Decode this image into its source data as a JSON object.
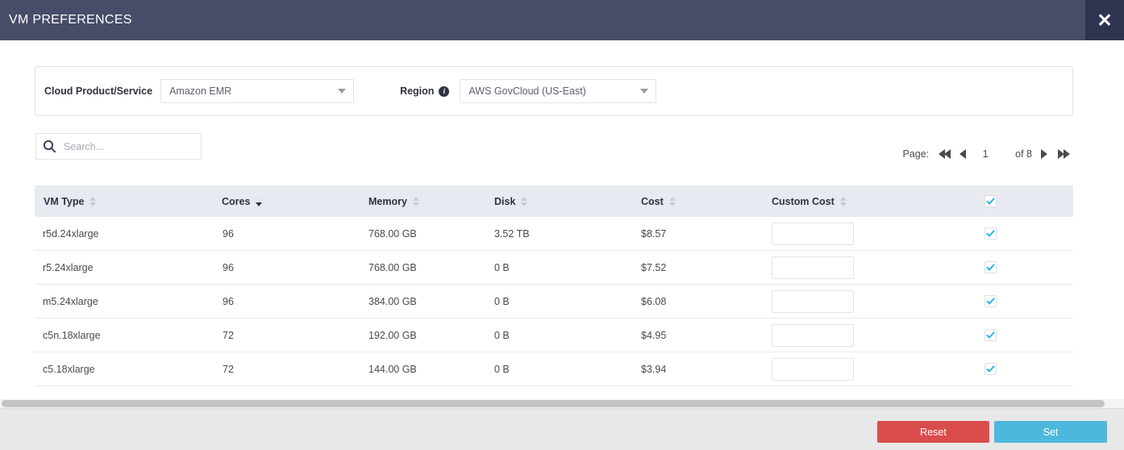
{
  "window": {
    "title": "VM PREFERENCES",
    "close_label": "✕",
    "header_bg": "#474c68",
    "close_bg": "#2e3350"
  },
  "filters": {
    "product": {
      "label": "Cloud Product/Service",
      "value": "Amazon EMR"
    },
    "region": {
      "label": "Region",
      "info_glyph": "i",
      "value": "AWS GovCloud (US-East)"
    }
  },
  "search": {
    "placeholder": "Search...",
    "value": ""
  },
  "pagination": {
    "label": "Page:",
    "current": "1",
    "of_label": "of 8",
    "total_pages": 8,
    "first_title": "First page",
    "prev_title": "Previous page",
    "next_title": "Next page",
    "last_title": "Last page"
  },
  "table": {
    "columns": [
      {
        "label": "VM Type",
        "sort": "none"
      },
      {
        "label": "Cores",
        "sort": "desc"
      },
      {
        "label": "Memory",
        "sort": "none"
      },
      {
        "label": "Disk",
        "sort": "none"
      },
      {
        "label": "Cost",
        "sort": "none"
      },
      {
        "label": "Custom Cost",
        "sort": "none"
      }
    ],
    "select_all_checked": true,
    "rows": [
      {
        "vm_type": "r5d.24xlarge",
        "cores": "96",
        "memory": "768.00 GB",
        "disk": "3.52 TB",
        "cost": "$8.57",
        "custom_cost": "",
        "checked": true
      },
      {
        "vm_type": "r5.24xlarge",
        "cores": "96",
        "memory": "768.00 GB",
        "disk": "0 B",
        "cost": "$7.52",
        "custom_cost": "",
        "checked": true
      },
      {
        "vm_type": "m5.24xlarge",
        "cores": "96",
        "memory": "384.00 GB",
        "disk": "0 B",
        "cost": "$6.08",
        "custom_cost": "",
        "checked": true
      },
      {
        "vm_type": "c5n.18xlarge",
        "cores": "72",
        "memory": "192.00 GB",
        "disk": "0 B",
        "cost": "$4.95",
        "custom_cost": "",
        "checked": true
      },
      {
        "vm_type": "c5.18xlarge",
        "cores": "72",
        "memory": "144.00 GB",
        "disk": "0 B",
        "cost": "$3.94",
        "custom_cost": "",
        "checked": true
      }
    ]
  },
  "footer": {
    "reset_label": "Reset",
    "set_label": "Set",
    "reset_color": "#db4c4c",
    "set_color": "#4eb7dc"
  },
  "colors": {
    "accent_blue": "#29b0e0",
    "header_row_bg": "#e8eaf1"
  }
}
